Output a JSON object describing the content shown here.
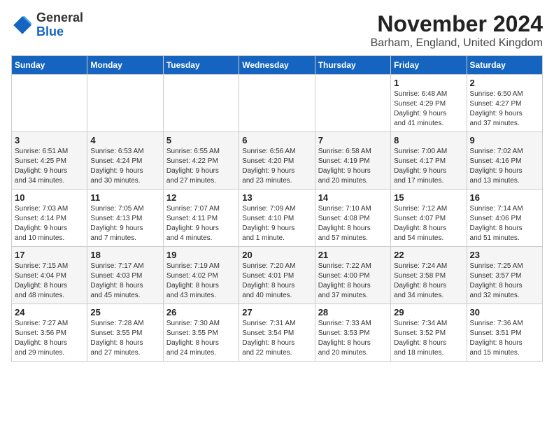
{
  "logo": {
    "general": "General",
    "blue": "Blue"
  },
  "header": {
    "month": "November 2024",
    "location": "Barham, England, United Kingdom"
  },
  "days_of_week": [
    "Sunday",
    "Monday",
    "Tuesday",
    "Wednesday",
    "Thursday",
    "Friday",
    "Saturday"
  ],
  "weeks": [
    [
      {
        "day": "",
        "info": ""
      },
      {
        "day": "",
        "info": ""
      },
      {
        "day": "",
        "info": ""
      },
      {
        "day": "",
        "info": ""
      },
      {
        "day": "",
        "info": ""
      },
      {
        "day": "1",
        "info": "Sunrise: 6:48 AM\nSunset: 4:29 PM\nDaylight: 9 hours\nand 41 minutes."
      },
      {
        "day": "2",
        "info": "Sunrise: 6:50 AM\nSunset: 4:27 PM\nDaylight: 9 hours\nand 37 minutes."
      }
    ],
    [
      {
        "day": "3",
        "info": "Sunrise: 6:51 AM\nSunset: 4:25 PM\nDaylight: 9 hours\nand 34 minutes."
      },
      {
        "day": "4",
        "info": "Sunrise: 6:53 AM\nSunset: 4:24 PM\nDaylight: 9 hours\nand 30 minutes."
      },
      {
        "day": "5",
        "info": "Sunrise: 6:55 AM\nSunset: 4:22 PM\nDaylight: 9 hours\nand 27 minutes."
      },
      {
        "day": "6",
        "info": "Sunrise: 6:56 AM\nSunset: 4:20 PM\nDaylight: 9 hours\nand 23 minutes."
      },
      {
        "day": "7",
        "info": "Sunrise: 6:58 AM\nSunset: 4:19 PM\nDaylight: 9 hours\nand 20 minutes."
      },
      {
        "day": "8",
        "info": "Sunrise: 7:00 AM\nSunset: 4:17 PM\nDaylight: 9 hours\nand 17 minutes."
      },
      {
        "day": "9",
        "info": "Sunrise: 7:02 AM\nSunset: 4:16 PM\nDaylight: 9 hours\nand 13 minutes."
      }
    ],
    [
      {
        "day": "10",
        "info": "Sunrise: 7:03 AM\nSunset: 4:14 PM\nDaylight: 9 hours\nand 10 minutes."
      },
      {
        "day": "11",
        "info": "Sunrise: 7:05 AM\nSunset: 4:13 PM\nDaylight: 9 hours\nand 7 minutes."
      },
      {
        "day": "12",
        "info": "Sunrise: 7:07 AM\nSunset: 4:11 PM\nDaylight: 9 hours\nand 4 minutes."
      },
      {
        "day": "13",
        "info": "Sunrise: 7:09 AM\nSunset: 4:10 PM\nDaylight: 9 hours\nand 1 minute."
      },
      {
        "day": "14",
        "info": "Sunrise: 7:10 AM\nSunset: 4:08 PM\nDaylight: 8 hours\nand 57 minutes."
      },
      {
        "day": "15",
        "info": "Sunrise: 7:12 AM\nSunset: 4:07 PM\nDaylight: 8 hours\nand 54 minutes."
      },
      {
        "day": "16",
        "info": "Sunrise: 7:14 AM\nSunset: 4:06 PM\nDaylight: 8 hours\nand 51 minutes."
      }
    ],
    [
      {
        "day": "17",
        "info": "Sunrise: 7:15 AM\nSunset: 4:04 PM\nDaylight: 8 hours\nand 48 minutes."
      },
      {
        "day": "18",
        "info": "Sunrise: 7:17 AM\nSunset: 4:03 PM\nDaylight: 8 hours\nand 45 minutes."
      },
      {
        "day": "19",
        "info": "Sunrise: 7:19 AM\nSunset: 4:02 PM\nDaylight: 8 hours\nand 43 minutes."
      },
      {
        "day": "20",
        "info": "Sunrise: 7:20 AM\nSunset: 4:01 PM\nDaylight: 8 hours\nand 40 minutes."
      },
      {
        "day": "21",
        "info": "Sunrise: 7:22 AM\nSunset: 4:00 PM\nDaylight: 8 hours\nand 37 minutes."
      },
      {
        "day": "22",
        "info": "Sunrise: 7:24 AM\nSunset: 3:58 PM\nDaylight: 8 hours\nand 34 minutes."
      },
      {
        "day": "23",
        "info": "Sunrise: 7:25 AM\nSunset: 3:57 PM\nDaylight: 8 hours\nand 32 minutes."
      }
    ],
    [
      {
        "day": "24",
        "info": "Sunrise: 7:27 AM\nSunset: 3:56 PM\nDaylight: 8 hours\nand 29 minutes."
      },
      {
        "day": "25",
        "info": "Sunrise: 7:28 AM\nSunset: 3:55 PM\nDaylight: 8 hours\nand 27 minutes."
      },
      {
        "day": "26",
        "info": "Sunrise: 7:30 AM\nSunset: 3:55 PM\nDaylight: 8 hours\nand 24 minutes."
      },
      {
        "day": "27",
        "info": "Sunrise: 7:31 AM\nSunset: 3:54 PM\nDaylight: 8 hours\nand 22 minutes."
      },
      {
        "day": "28",
        "info": "Sunrise: 7:33 AM\nSunset: 3:53 PM\nDaylight: 8 hours\nand 20 minutes."
      },
      {
        "day": "29",
        "info": "Sunrise: 7:34 AM\nSunset: 3:52 PM\nDaylight: 8 hours\nand 18 minutes."
      },
      {
        "day": "30",
        "info": "Sunrise: 7:36 AM\nSunset: 3:51 PM\nDaylight: 8 hours\nand 15 minutes."
      }
    ]
  ]
}
